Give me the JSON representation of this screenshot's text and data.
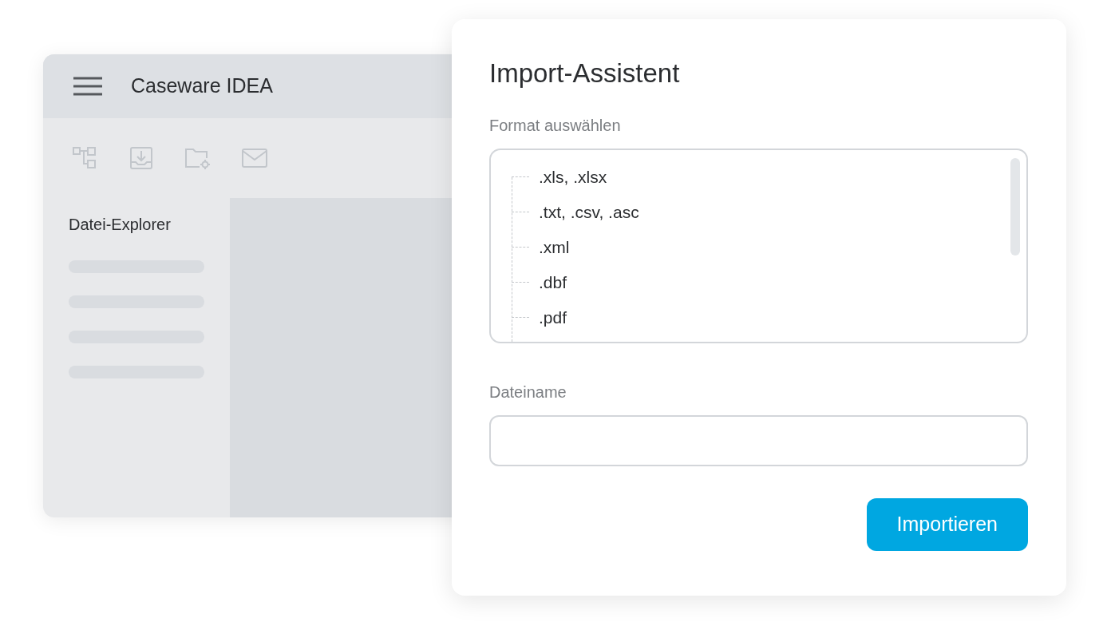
{
  "app_window": {
    "title": "Caseware IDEA",
    "sidebar_title": "Datei-Explorer",
    "placeholder_rows": [
      {
        "kind": "bar"
      },
      {
        "kind": "bar"
      },
      {
        "kind": "bar"
      },
      {
        "kind": "bar"
      }
    ]
  },
  "dialog": {
    "title": "Import-Assistent",
    "format_label": "Format auswählen",
    "formats": [
      {
        "label": ".xls, .xlsx"
      },
      {
        "label": ".txt, .csv, .asc"
      },
      {
        "label": ".xml"
      },
      {
        "label": ".dbf"
      },
      {
        "label": ".pdf"
      }
    ],
    "filename_label": "Dateiname",
    "button": "Importieren"
  }
}
